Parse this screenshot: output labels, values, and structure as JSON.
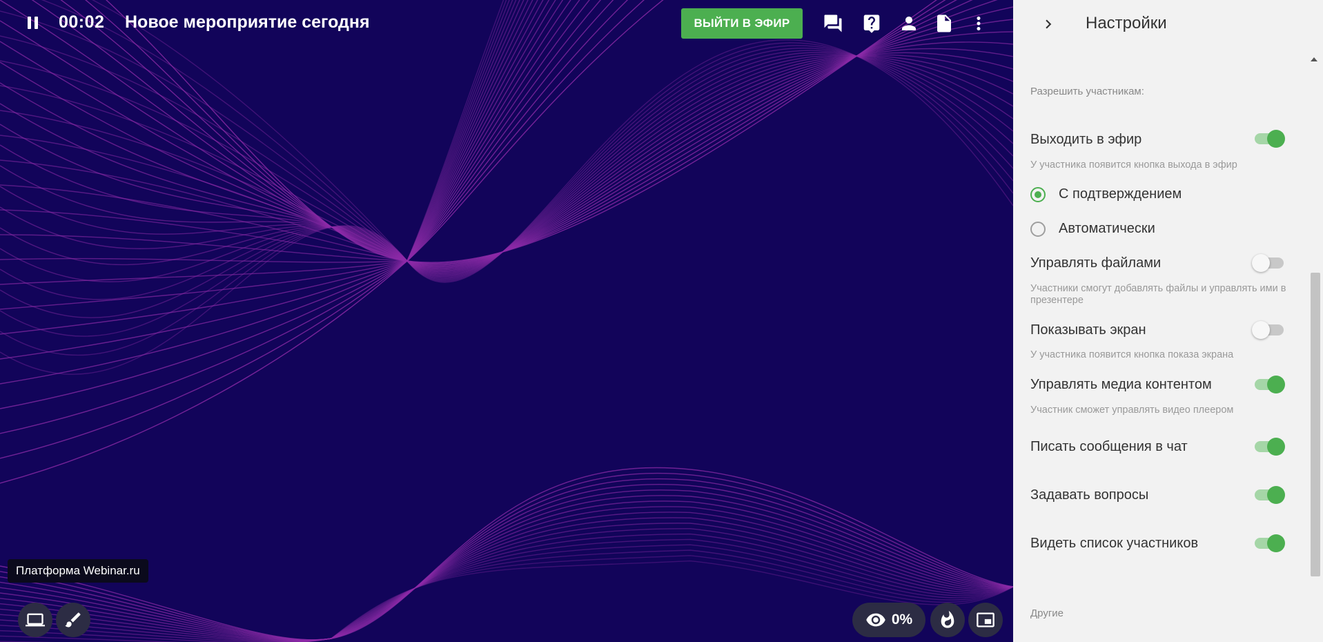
{
  "header": {
    "timer": "00:02",
    "event_title": "Новое мероприятие сегодня",
    "go_live_label": "ВЫЙТИ В ЭФИР"
  },
  "toolbar_icons": [
    "chat-icon",
    "question-icon",
    "person-icon",
    "document-icon",
    "more-vert-icon"
  ],
  "stage": {
    "platform_tag": "Платформа Webinar.ru",
    "views_percent": "0%"
  },
  "colors": {
    "stage_bg": "#12045a",
    "accent_green": "#4caf50",
    "panel_bg": "#f2f2f2",
    "wave": "#8e2ba8"
  },
  "settings": {
    "title": "Настройки",
    "allow_section": "Разрешить участникам:",
    "go_live": {
      "label": "Выходить в эфир",
      "desc": "У участника появится кнопка выхода в эфир",
      "enabled": true,
      "options": [
        "С подтверждением",
        "Автоматически"
      ],
      "selected": "С подтверждением"
    },
    "manage_files": {
      "label": "Управлять файлами",
      "desc": "Участники смогут добавлять файлы и управлять ими в презентере",
      "enabled": false
    },
    "share_screen": {
      "label": "Показывать экран",
      "desc": "У участника появится кнопка показа экрана",
      "enabled": false
    },
    "manage_media": {
      "label": "Управлять медиа контентом",
      "desc": "Участник сможет управлять видео плеером",
      "enabled": true
    },
    "write_chat": {
      "label": "Писать сообщения в чат",
      "enabled": true
    },
    "ask_questions": {
      "label": "Задавать вопросы",
      "enabled": true
    },
    "see_participants": {
      "label": "Видеть список участников",
      "enabled": true
    },
    "other_section": "Другие"
  }
}
